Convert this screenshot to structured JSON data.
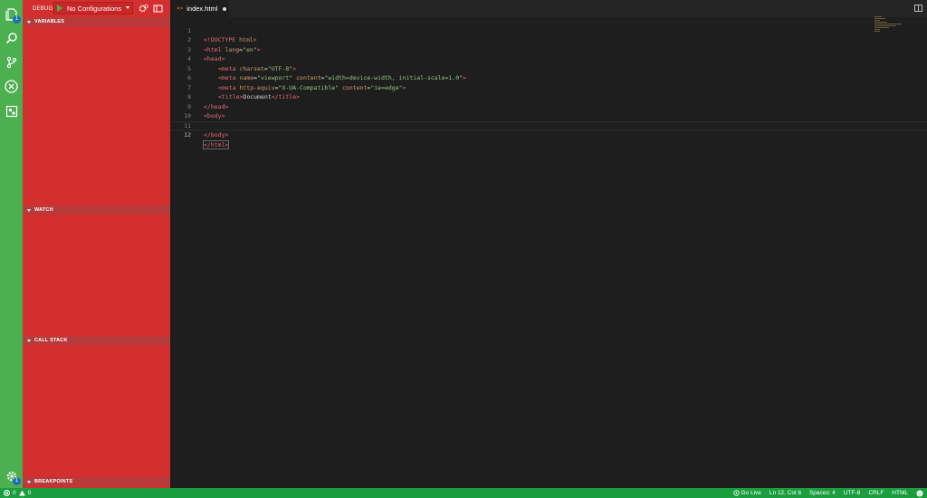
{
  "activity_bar": {
    "explorer_badge": "1",
    "settings_badge": "1"
  },
  "debug": {
    "title": "DEBUG",
    "configuration": "No Configurations"
  },
  "sections": {
    "variables": "VARIABLES",
    "watch": "WATCH",
    "call_stack": "CALL STACK",
    "breakpoints": "BREAKPOINTS"
  },
  "editor": {
    "tab_icon": "<>",
    "tab_label": "index.html",
    "lines": [
      {
        "num": "1"
      },
      {
        "num": "2"
      },
      {
        "num": "3"
      },
      {
        "num": "4"
      },
      {
        "num": "5"
      },
      {
        "num": "6"
      },
      {
        "num": "7"
      },
      {
        "num": "8"
      },
      {
        "num": "9"
      },
      {
        "num": "10"
      },
      {
        "num": "11"
      },
      {
        "num": "12"
      }
    ],
    "code": {
      "l1": {
        "a": "<!DOCTYPE ",
        "b": "html",
        "c": ">"
      },
      "l2": {
        "a": "<html ",
        "b": "lang",
        "c": "=",
        "d": "\"en\"",
        "e": ">"
      },
      "l3": {
        "a": "<head>"
      },
      "l4": {
        "a": "<meta ",
        "b": "charset",
        "c": "=",
        "d": "\"UTF-8\"",
        "e": ">"
      },
      "l5": {
        "a": "<meta ",
        "b": "name",
        "c": "=",
        "d": "\"viewport\"",
        "e": " ",
        "f": "content",
        "g": "=",
        "h": "\"width=device-width, initial-scale=1.0\"",
        "i": ">"
      },
      "l6": {
        "a": "<meta ",
        "b": "http-equiv",
        "c": "=",
        "d": "\"X-UA-Compatible\"",
        "e": " ",
        "f": "content",
        "g": "=",
        "h": "\"ie=edge\"",
        "i": ">"
      },
      "l7": {
        "a": "<title>",
        "b": "Document",
        "c": "</title>"
      },
      "l8": {
        "a": "</head>"
      },
      "l9": {
        "a": "<body>"
      },
      "l11": {
        "a": "</body>"
      },
      "l12": {
        "a": "</html>"
      }
    }
  },
  "status": {
    "errors": "0",
    "warnings": "0",
    "go_live": "Go Live",
    "position": "Ln 12, Col 8",
    "spaces": "Spaces: 4",
    "encoding": "UTF-8",
    "eol": "CRLF",
    "language": "HTML"
  },
  "colors": {
    "activity_bar": "#4caf50",
    "sidebar": "#d32f2f",
    "status_bar": "#1b9e3e",
    "editor_bg": "#1e1e1e"
  }
}
